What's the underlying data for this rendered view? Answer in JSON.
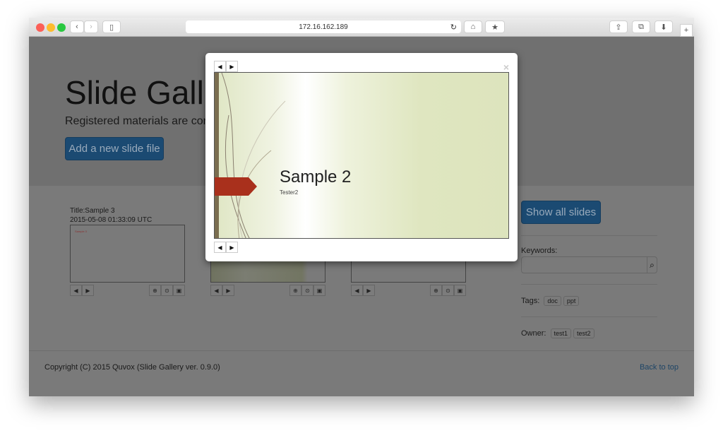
{
  "browser": {
    "url": "172.16.162.189"
  },
  "jumbotron": {
    "title": "Slide Gall",
    "lead": "Registered materials are conve",
    "add_button": "Add a new slide file"
  },
  "cards": [
    {
      "title": "Title:Sample 3",
      "date": "2015-05-08 01:33:09 UTC",
      "thumb_text": "Sample 3"
    },
    {
      "title": "",
      "date": ""
    },
    {
      "title": "",
      "date": ""
    }
  ],
  "sidebar": {
    "show_all": "Show all slides",
    "keywords_label": "Keywords:",
    "keywords_value": "",
    "tags_label": "Tags:",
    "tags": [
      "doc",
      "ppt"
    ],
    "owner_label": "Owner:",
    "owners": [
      "test1",
      "test2"
    ]
  },
  "footer": {
    "copyright": "Copyright (C) 2015 Quvox (Slide Gallery ver. 0.9.0)",
    "back_to_top": "Back to top"
  },
  "modal": {
    "close": "×",
    "slide_title": "Sample 2",
    "slide_subtitle": "Tester2"
  },
  "colors": {
    "primary": "#337ab7",
    "slide_ribbon": "#a9301c",
    "overlay": "#777777"
  }
}
